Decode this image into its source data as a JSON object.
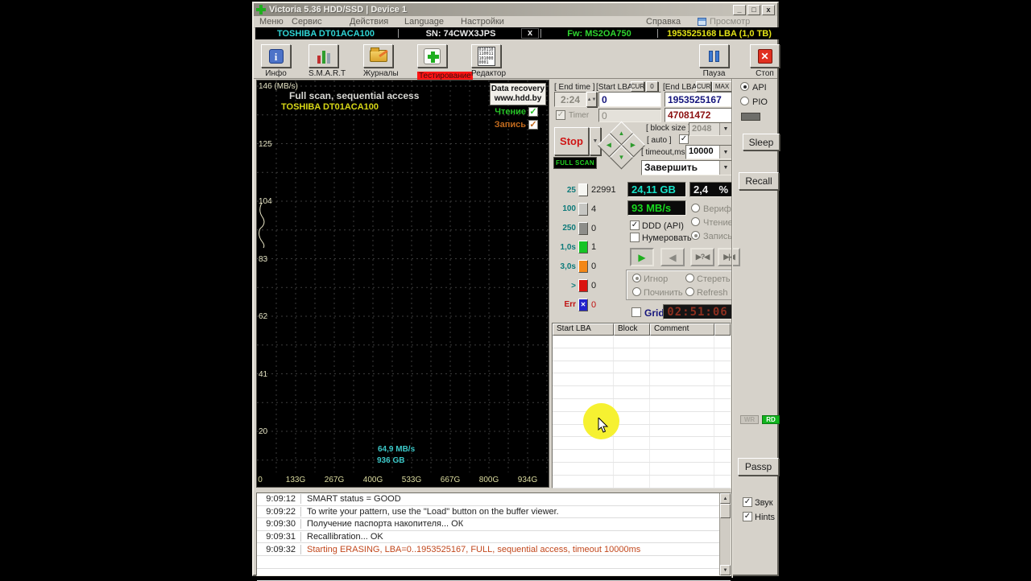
{
  "window": {
    "title": "Victoria 5.36 HDD/SSD | Device 1",
    "minimize": "_",
    "maximize": "□",
    "close": "x"
  },
  "menu": {
    "items": [
      "Меню",
      "Сервис",
      "Действия",
      "Language",
      "Настройки"
    ],
    "help": "Справка",
    "buffer_view": "Просмотр буфера"
  },
  "device_bar": {
    "model": "TOSHIBA DT01ACA100",
    "serial": "SN: 74CWX3JPS",
    "close": "x",
    "firmware": "Fw: MS2OA750",
    "capacity": "1953525168 LBA (1,0 ТВ)"
  },
  "toolbar": {
    "info": "Инфо",
    "smart": "S.M.A.R.T",
    "logs": "Журналы",
    "test": "Тестирование",
    "editor": "Редактор",
    "pause": "Пауза",
    "stop": "Стоп",
    "editor_icon_text": "010110 110011 101000 0001"
  },
  "graph": {
    "title": "Full scan, sequential access",
    "drive": "TOSHIBA DT01ACA100",
    "watermark1": "Data recovery",
    "watermark2": "www.hdd.by",
    "read_label": "Чтение",
    "write_label": "Запись",
    "y_ticks": [
      "146 (MB/s)",
      "125",
      "104",
      "83",
      "62",
      "41",
      "20"
    ],
    "x_ticks": [
      "0",
      "133G",
      "267G",
      "400G",
      "533G",
      "667G",
      "800G",
      "934G"
    ],
    "cursor_speed": "64,9 MB/s",
    "cursor_pos": "936 GB"
  },
  "scan": {
    "end_time_label": "[ End time ]",
    "end_time": "2:24",
    "timer_label": "Timer",
    "timer_value": "0",
    "start_lba_label": "[Start LBA]",
    "cur_btn": "CUR",
    "zero_btn": "0",
    "start_lba": "0",
    "end_lba_label": "[End LBA]",
    "cur2_btn": "CUR",
    "max_btn": "MAX",
    "end_lba": "1953525167",
    "current_lba": "47081472",
    "stop": "Stop",
    "full_scan": "FULL SCAN",
    "block_size_label": "[ block size ]",
    "block_size": "2048",
    "auto_label": "[ auto ]",
    "timeout_label": "[ timeout,ms ]",
    "timeout": "10000",
    "action": "Завершить"
  },
  "legend": {
    "rows": [
      {
        "label": "25",
        "count": "22991",
        "color": "#f6f6f2",
        "err": false
      },
      {
        "label": "100",
        "count": "4",
        "color": "#c6c6c2",
        "err": false
      },
      {
        "label": "250",
        "count": "0",
        "color": "#8e8e8a",
        "err": false
      },
      {
        "label": "1,0s",
        "count": "1",
        "color": "#16c426",
        "err": false
      },
      {
        "label": "3,0s",
        "count": "0",
        "color": "#f38716",
        "err": false
      },
      {
        "label": ">",
        "count": "0",
        "color": "#da1410",
        "err": false
      },
      {
        "label": "Err",
        "count": "0",
        "color": "#2222cc",
        "err": true,
        "mark": "✕"
      }
    ]
  },
  "lcd": {
    "volume": "24,11 GB",
    "percent": "2,4",
    "percent_unit": "%",
    "speed": "93 MB/s",
    "clock": "02:51:06"
  },
  "mode": {
    "ddd": "DDD (API)",
    "numerate": "Нумеровать",
    "verify": "Вериф.",
    "read": "Чтение",
    "write": "Запись"
  },
  "playback": {
    "play": "▶",
    "rew": "◀",
    "seek": "▶?◀",
    "step": "▶|◀"
  },
  "actions": {
    "ignore": "Игнор",
    "erase": "Стереть",
    "repair": "Починить",
    "refresh": "Refresh",
    "grid": "Grid"
  },
  "table": {
    "headers": [
      "Start LBA",
      "Block",
      "Comment"
    ]
  },
  "sidebar": {
    "api": "API",
    "pio": "PIO",
    "sleep": "Sleep",
    "recall": "Recall",
    "wr": "WR",
    "rd": "RD",
    "passp": "Passp",
    "sound": "Звук",
    "hints": "Hints"
  },
  "log": {
    "entries": [
      {
        "time": "9:09:12",
        "message": "SMART status = GOOD",
        "highlight": false
      },
      {
        "time": "9:09:22",
        "message": "To write your pattern, use the \"Load\" button on the buffer viewer.",
        "highlight": false
      },
      {
        "time": "9:09:30",
        "message": "Получение паспорта накопителя... ОК",
        "highlight": false
      },
      {
        "time": "9:09:31",
        "message": "Recallibration... OK",
        "highlight": false
      },
      {
        "time": "9:09:32",
        "message": "Starting ERASING, LBA=0..1953525167, FULL, sequential access, timeout 10000ms",
        "highlight": true
      }
    ]
  },
  "colors": {
    "accent_red": "#ff1414",
    "lcd_cyan": "#17e2c8",
    "lcd_green": "#17d81e",
    "clock_red": "#8d2f1f",
    "rd_green": "#11b41e"
  }
}
